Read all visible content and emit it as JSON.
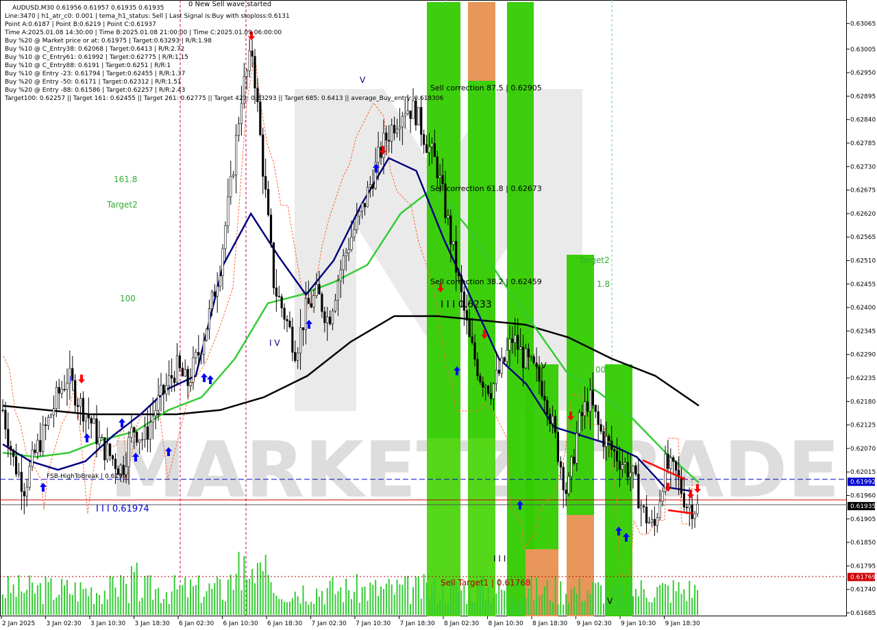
{
  "header": {
    "lines": [
      "AUDUSD,M30  0.61956 0.61957 0.61935 0.61935",
      "Line:3470  |  h1_atr_c0: 0.001  |  tema_h1_status: Sell  |  Last Signal is:Buy with stoploss:0.6131",
      "Point A:0.6187  |  Point B:0.6219  |  Point C:0.61937",
      "Time A:2025.01.08 14:30:00  |  Time B:2025.01.08 21:00:00  |  Time C:2025.01.09 06:00:00",
      "Buy %20 @ Market price or at: 0.61975  |  Target:0.63293  |  R/R:1.98",
      "Buy %10 @ C_Entry38: 0.62068  |  Target:0.6413  |  R/R:2.72",
      "Buy %10 @ C_Entry61: 0.61992  |  Target:0.62775  |  R/R:1.15",
      "Buy %10 @ C_Entry88: 0.6191  |  Target:0.6251  |  R/R:1",
      "Buy %10 @ Entry -23: 0.61794  |  Target:0.62455  |  R/R:1.37",
      "Buy %20 @ Entry -50: 0.6171  |  Target:0.62312  |  R/R:1.51",
      "Buy %20 @ Entry -88: 0.61586  |  Target:0.62257  |  R/R:2.43",
      "Target100: 0.62257  ||  Target 161: 0.62455  ||  Target 261: 0.62775  ||  Target 423: 0.63293  ||  Target 685: 0.6413  ||  average_Buy_entry: 0.618306"
    ],
    "top_label": "0 New Sell wave started"
  },
  "labels": {
    "target_161": "161.8",
    "target2_left": "Target2",
    "target_100": "100",
    "iv_label": "I V",
    "v_top": "V",
    "fsb": "FSB-HighToBreak  |  0.6199",
    "level_left": "I I I  0.61974",
    "i_marker": "I",
    "corr_875": "Sell correction 87.5  |  0.62905",
    "corr_618": "Sell correction 61.8  |  0.62673",
    "corr_382": "Sell correction 38.2  |  0.62459",
    "mid_level": "I I I  0.6233",
    "target2_right": "Target2",
    "right_618": "1.8",
    "right_100": "00",
    "iv_right": "I V",
    "sell_target": "Sell Target1  |  0.61768",
    "iii_bottom": "I I I",
    "v_bottom": "V",
    "watermark": "MARKETZITRADE"
  },
  "colors": {
    "background": "#ffffff",
    "bull_candle": "#000000",
    "bear_candle": "#000000",
    "ema_blue": "#000080",
    "ema_green": "#33cc33",
    "ema_black": "#000000",
    "zone_green": "#33cc00",
    "zone_orange": "#e8965a",
    "volume": "#33cc33",
    "buy_arrow": "#0000ff",
    "sell_arrow": "#ff0000",
    "stop_line": "#ff3300",
    "blue_level": "#0000cc",
    "red_level": "#cc0000"
  },
  "chart_data": {
    "type": "candlestick",
    "symbol": "AUDUSD",
    "timeframe": "M30",
    "ylim": [
      0.61685,
      0.6308
    ],
    "price_ticks": [
      "0.63065",
      "0.63005",
      "0.62950",
      "0.62895",
      "0.62840",
      "0.62785",
      "0.62730",
      "0.62675",
      "0.62620",
      "0.62565",
      "0.62510",
      "0.62455",
      "0.62400",
      "0.62345",
      "0.62290",
      "0.62235",
      "0.62180",
      "0.62125",
      "0.62070",
      "0.62015",
      "0.61960",
      "0.61905",
      "0.61850",
      "0.61795",
      "0.61740",
      "0.61685"
    ],
    "time_ticks": [
      "2 Jan 2025",
      "3 Jan 02:30",
      "3 Jan 10:30",
      "3 Jan 18:30",
      "6 Jan 02:30",
      "6 Jan 10:30",
      "6 Jan 18:30",
      "7 Jan 02:30",
      "7 Jan 10:30",
      "7 Jan 18:30",
      "8 Jan 02:30",
      "8 Jan 10:30",
      "8 Jan 18:30",
      "9 Jan 02:30",
      "9 Jan 10:30",
      "9 Jan 18:30"
    ],
    "price_tags": [
      {
        "label": "0.61992",
        "value": 0.61992,
        "color": "#0000cc"
      },
      {
        "label": "0.61935",
        "value": 0.61935,
        "color": "#000000"
      },
      {
        "label": "0.61769",
        "value": 0.61769,
        "color": "#cc0000"
      }
    ],
    "close_profile": [
      0.6216,
      0.6204,
      0.6198,
      0.6206,
      0.6212,
      0.6219,
      0.6224,
      0.6218,
      0.6214,
      0.6208,
      0.6205,
      0.6202,
      0.6212,
      0.6209,
      0.6216,
      0.6221,
      0.6226,
      0.6222,
      0.6229,
      0.6238,
      0.625,
      0.6268,
      0.629,
      0.63,
      0.6272,
      0.6245,
      0.6238,
      0.623,
      0.624,
      0.6243,
      0.6237,
      0.6248,
      0.6256,
      0.6262,
      0.627,
      0.6278,
      0.6283,
      0.6287,
      0.6286,
      0.6279,
      0.6273,
      0.626,
      0.6246,
      0.6232,
      0.6224,
      0.6221,
      0.6226,
      0.6233,
      0.6228,
      0.6225,
      0.622,
      0.6208,
      0.6196,
      0.6212,
      0.6219,
      0.6211,
      0.6207,
      0.6204,
      0.6201,
      0.6192,
      0.6188,
      0.6203,
      0.6201,
      0.6194,
      0.6193
    ],
    "ema_blue": [
      0.6208,
      0.6204,
      0.6202,
      0.6204,
      0.621,
      0.6215,
      0.6221,
      0.6224,
      0.625,
      0.6262,
      0.6252,
      0.6243,
      0.6251,
      0.6264,
      0.6275,
      0.6272,
      0.6256,
      0.6242,
      0.6228,
      0.6222,
      0.6212,
      0.621,
      0.6208,
      0.6205,
      0.6198,
      0.6197
    ],
    "ema_green": [
      0.6206,
      0.6205,
      0.6206,
      0.6209,
      0.6211,
      0.6216,
      0.6219,
      0.6228,
      0.6241,
      0.6243,
      0.6246,
      0.625,
      0.6262,
      0.6268,
      0.6259,
      0.6247,
      0.6236,
      0.6225,
      0.622,
      0.6214,
      0.6206,
      0.6199
    ],
    "ema_black": [
      0.6217,
      0.6216,
      0.6215,
      0.6215,
      0.6215,
      0.6216,
      0.6219,
      0.6224,
      0.6232,
      0.6238,
      0.6238,
      0.6237,
      0.6236,
      0.6233,
      0.6228,
      0.6224,
      0.6217
    ],
    "levels": {
      "fsb": 0.6199,
      "left_level": 0.61974,
      "sell_target": 0.61768,
      "current": 0.61935
    }
  }
}
